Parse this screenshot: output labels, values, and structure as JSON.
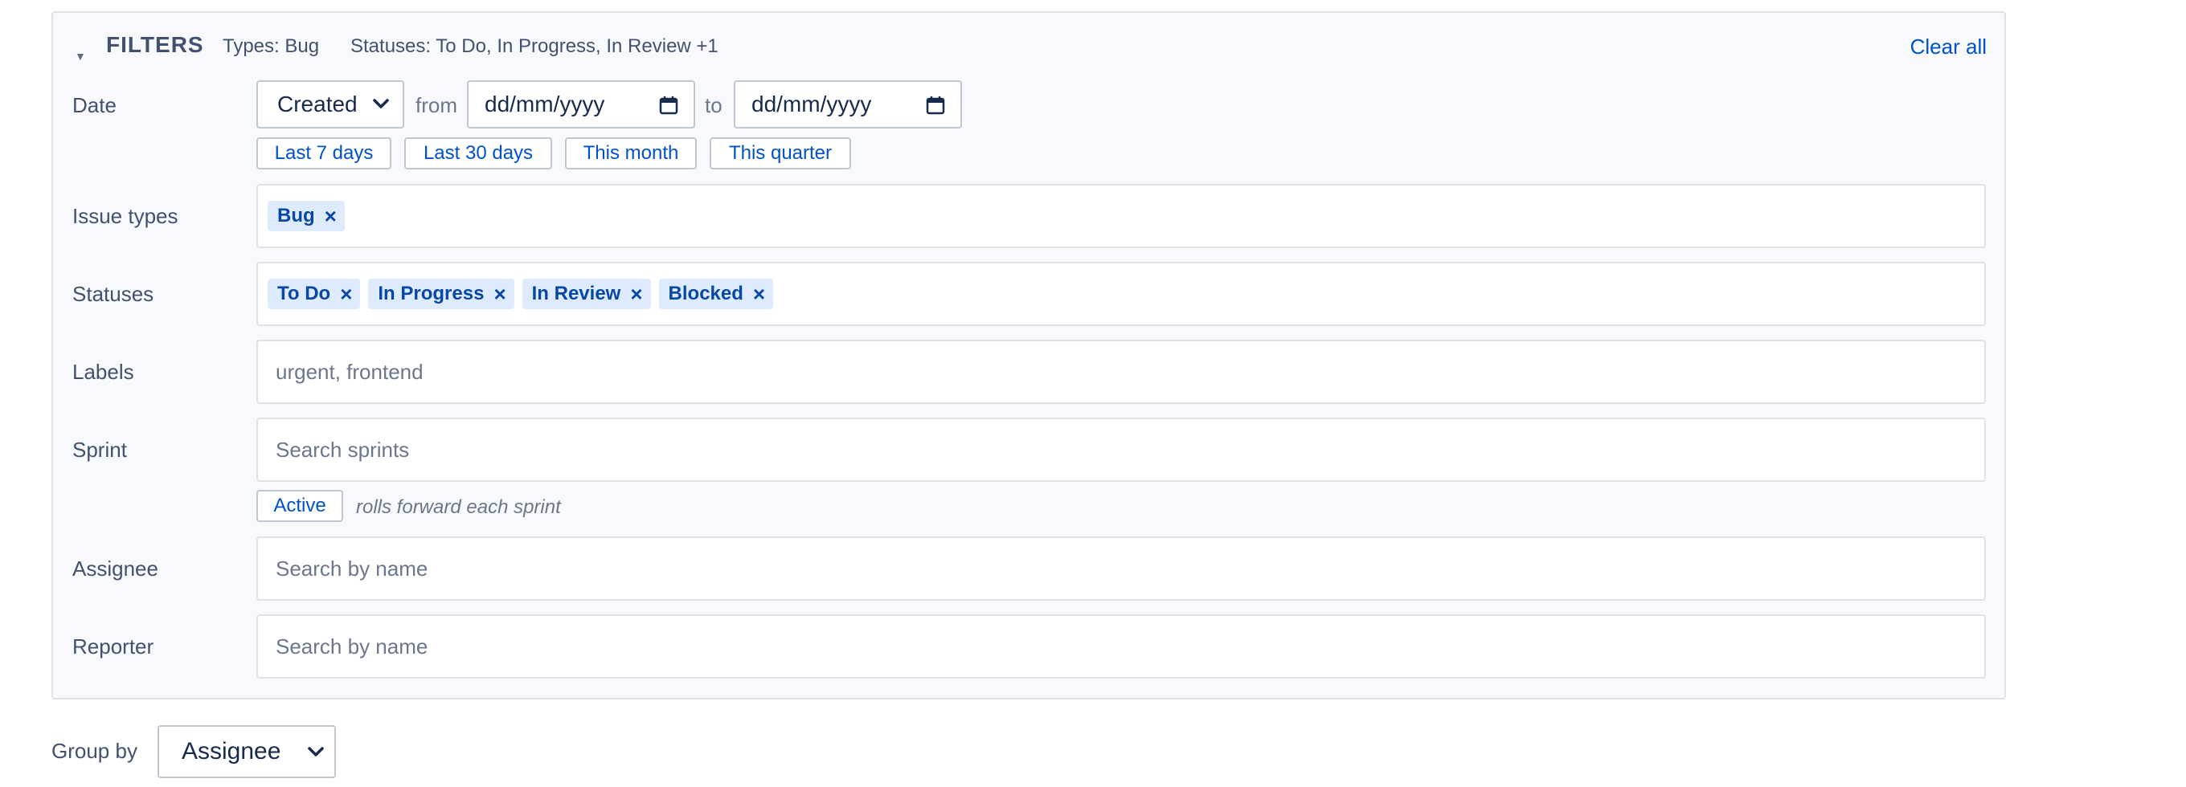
{
  "filters": {
    "title": "FILTERS",
    "collapse_icon": "caret-down-icon",
    "summary_types": "Types: Bug",
    "summary_statuses": "Statuses: To Do, In Progress, In Review +1",
    "clear_all": "Clear all"
  },
  "date": {
    "label": "Date",
    "field_select": "Created",
    "from_word": "from",
    "to_word": "to",
    "from_value": "dd/mm/yyyy",
    "to_value": "dd/mm/yyyy",
    "presets": [
      "Last 7 days",
      "Last 30 days",
      "This month",
      "This quarter"
    ]
  },
  "issue_types": {
    "label": "Issue types",
    "tags": [
      "Bug"
    ]
  },
  "statuses": {
    "label": "Statuses",
    "tags": [
      "To Do",
      "In Progress",
      "In Review",
      "Blocked"
    ]
  },
  "labels": {
    "label": "Labels",
    "placeholder": "urgent, frontend"
  },
  "sprint": {
    "label": "Sprint",
    "placeholder": "Search sprints",
    "active_chip": "Active",
    "active_note": "rolls forward each sprint"
  },
  "assignee": {
    "label": "Assignee",
    "placeholder": "Search by name"
  },
  "reporter": {
    "label": "Reporter",
    "placeholder": "Search by name"
  },
  "group_by": {
    "label": "Group by",
    "value": "Assignee"
  },
  "tag_remove_glyph": "×"
}
